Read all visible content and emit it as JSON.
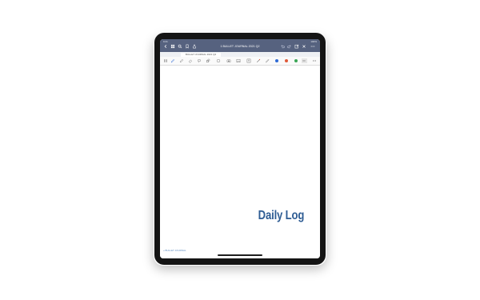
{
  "status_bar": {
    "time": "9:41",
    "indicators": "100%"
  },
  "title_bar": {
    "document_title": "1 BULLET JOURNAL 2021 Q2",
    "left_icons": [
      "back-icon",
      "grid-icon",
      "search-icon",
      "bookmark-icon",
      "share-icon"
    ],
    "right_icons": [
      "undo-icon",
      "redo-icon",
      "edit-icon",
      "close-icon",
      "more-icon"
    ]
  },
  "tabs": [
    {
      "label": "BULLET JOURNAL 2021 Q2"
    }
  ],
  "toolbar": {
    "tools": [
      "sidebar-icon",
      "pen-icon",
      "highlighter-icon",
      "eraser-icon",
      "lasso-icon",
      "shapes-icon",
      "ellipse-icon",
      "camera-icon",
      "image-icon",
      "text-icon",
      "laser-pointer-icon",
      "ruler-icon"
    ],
    "colors": [
      "#2f6bd6",
      "#e05a3a",
      "#3aa655"
    ],
    "more": "more-icon"
  },
  "page": {
    "heading": "Daily Log",
    "footer_link": "« BULLET JOURNAL"
  },
  "colors": {
    "title_bar": "#56627f",
    "heading": "#2f5d94",
    "device_bezel": "#141414"
  }
}
